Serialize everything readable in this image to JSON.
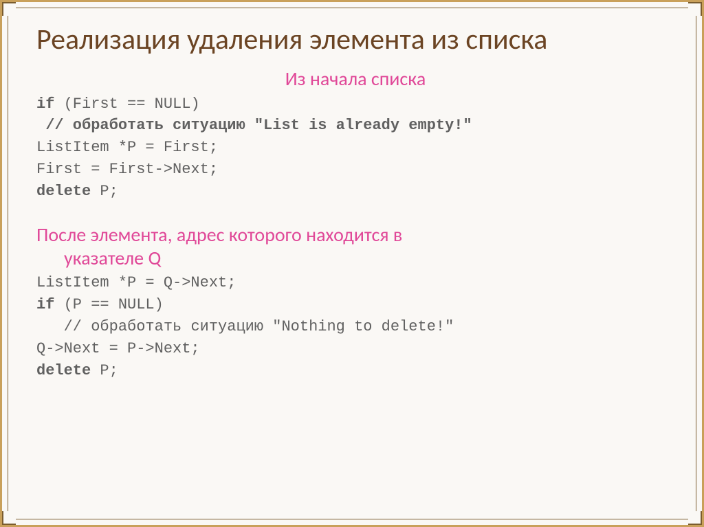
{
  "title": "Реализация удаления элемента из списка",
  "section1": {
    "heading": "Из начала списка",
    "line1_kw": "if",
    "line1_rest": " (First == NULL)",
    "line2_prefix": " ",
    "line2_comment": "// обработать ситуацию \"List is already empty!\"",
    "line3": "ListItem *P = First;",
    "line4": "First = First->Next;",
    "line5_kw": "delete",
    "line5_rest": " P;"
  },
  "section2": {
    "heading_line1": "После элемента, адрес которого находится в",
    "heading_line2": "указателе Q",
    "line1": "ListItem *P = Q->Next;",
    "line2_kw": "if",
    "line2_rest": " (P == NULL)",
    "line3_prefix": "   ",
    "line3_comment": "// обработать ситуацию \"Nothing to delete!\"",
    "line4": "Q->Next = P->Next;",
    "line5_kw": "delete",
    "line5_rest": " P;"
  }
}
